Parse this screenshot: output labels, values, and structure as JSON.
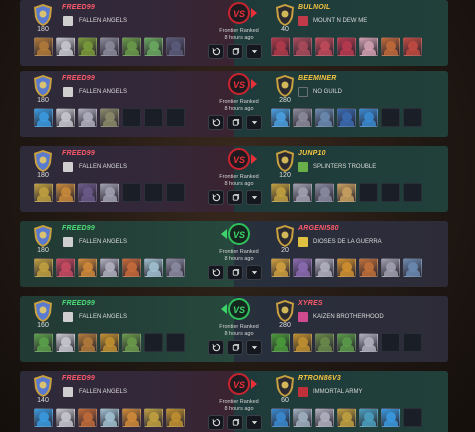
{
  "matches": [
    {
      "result": "loss",
      "vs_label": "VS",
      "mode": "Frontier Ranked",
      "time": "8 hours ago",
      "left": {
        "name": "FREED99",
        "name_color": "#ff5a6a",
        "rating": "180",
        "guild": "FALLEN ANGELS",
        "guild_color": "#cfcfcf",
        "cards": [
          "#b07a3a",
          "#c8c8d0",
          "#7a9a3a",
          "#8a8a9a",
          "#6a9a4a",
          "#6aa860",
          "#5a5a7a"
        ]
      },
      "right": {
        "name": "BULNOIL",
        "name_color": "#f5c542",
        "rating": "40",
        "guild": "MOUNT N DEW ME",
        "guild_color": "#c03a4a",
        "cards": [
          "#b03a4a",
          "#a84a5a",
          "#c04a5a",
          "#b83a50",
          "#d0a0b0",
          "#c06a3a",
          "#c04a40"
        ]
      }
    },
    {
      "result": "loss",
      "vs_label": "VS",
      "mode": "Frontier Ranked",
      "time": "8 hours ago",
      "left": {
        "name": "FREED99",
        "name_color": "#ff5a6a",
        "rating": "180",
        "guild": "FALLEN ANGELS",
        "guild_color": "#cfcfcf",
        "cards": [
          "#3a9ae0",
          "#c8c8d0",
          "#b0b0c0",
          "#8a8a6a",
          "empty",
          "empty",
          "empty"
        ]
      },
      "right": {
        "name": "BEEMINER",
        "name_color": "#f5c542",
        "rating": "280",
        "guild": "NO GUILD",
        "guild_color": "#505860",
        "cards": [
          "#4aa0e0",
          "#8a8a9a",
          "#6a8ab0",
          "#3a6ab0",
          "#3a8ad0",
          "empty",
          "empty"
        ]
      }
    },
    {
      "result": "loss",
      "vs_label": "VS",
      "mode": "Frontier Ranked",
      "time": "8 hours ago",
      "left": {
        "name": "FREED99",
        "name_color": "#ff5a6a",
        "rating": "180",
        "guild": "FALLEN ANGELS",
        "guild_color": "#cfcfcf",
        "cards": [
          "#c0a040",
          "#c88a3a",
          "#6a5a8a",
          "#a0a0b0",
          "empty",
          "empty",
          "empty"
        ]
      },
      "right": {
        "name": "JUNP10",
        "name_color": "#f5c542",
        "rating": "120",
        "guild": "SPLINTERS TROUBLE",
        "guild_color": "#6ab04a",
        "cards": [
          "#c0a040",
          "#a0a0b0",
          "#8a8aa0",
          "#c8a060",
          "empty",
          "empty",
          "empty"
        ]
      }
    },
    {
      "result": "win",
      "vs_label": "VS",
      "mode": "Frontier Ranked",
      "time": "8 hours ago",
      "left": {
        "name": "FREED99",
        "name_color": "#4ee07a",
        "rating": "180",
        "guild": "FALLEN ANGELS",
        "guild_color": "#cfcfcf",
        "cards": [
          "#c0a040",
          "#c84a60",
          "#d08a3a",
          "#b0b0c0",
          "#c86a3a",
          "#a0c0d0",
          "#8a8aa0"
        ]
      },
      "right": {
        "name": "ARGENI580",
        "name_color": "#ff5a6a",
        "rating": "20",
        "guild": "DIOSES DE LA GUERRA",
        "guild_color": "#e0c040",
        "cards": [
          "#d0a040",
          "#8a6ab0",
          "#b0b0c0",
          "#d09030",
          "#c0703a",
          "#a0a0b0",
          "#6a8ab0"
        ]
      }
    },
    {
      "result": "win",
      "vs_label": "VS",
      "mode": "Frontier Ranked",
      "time": "8 hours ago",
      "left": {
        "name": "FREED99",
        "name_color": "#4ee07a",
        "rating": "160",
        "guild": "FALLEN ANGELS",
        "guild_color": "#cfcfcf",
        "cards": [
          "#5aa04a",
          "#c8c8d0",
          "#b07a3a",
          "#c09030",
          "#6a9a4a",
          "empty",
          "empty"
        ]
      },
      "right": {
        "name": "XYRES",
        "name_color": "#ff5a6a",
        "rating": "280",
        "guild": "KAIZEN BROTHERHOOD",
        "guild_color": "#d04a90",
        "cards": [
          "#4a9a3a",
          "#c09030",
          "#6a8a4a",
          "#5a9a4a",
          "#b0b0c0",
          "empty",
          "empty"
        ]
      }
    },
    {
      "result": "loss",
      "vs_label": "VS",
      "mode": "Frontier Ranked",
      "time": "8 hours ago",
      "left": {
        "name": "FREED99",
        "name_color": "#ff5a6a",
        "rating": "140",
        "guild": "FALLEN ANGELS",
        "guild_color": "#cfcfcf",
        "cards": [
          "#3a9ae0",
          "#c8c8d0",
          "#c06a3a",
          "#a0c0d0",
          "#d08a3a",
          "#c0a040",
          "#c09030"
        ]
      },
      "right": {
        "name": "RTRON86V3",
        "name_color": "#f5c542",
        "rating": "60",
        "guild": "IMMORTAL ARMY",
        "guild_color": "#c0303a",
        "cards": [
          "#3a8ad0",
          "#a0b0c0",
          "#b0b0c0",
          "#c0a040",
          "#4aa0c0",
          "#3a9ae0",
          "empty"
        ]
      }
    }
  ]
}
